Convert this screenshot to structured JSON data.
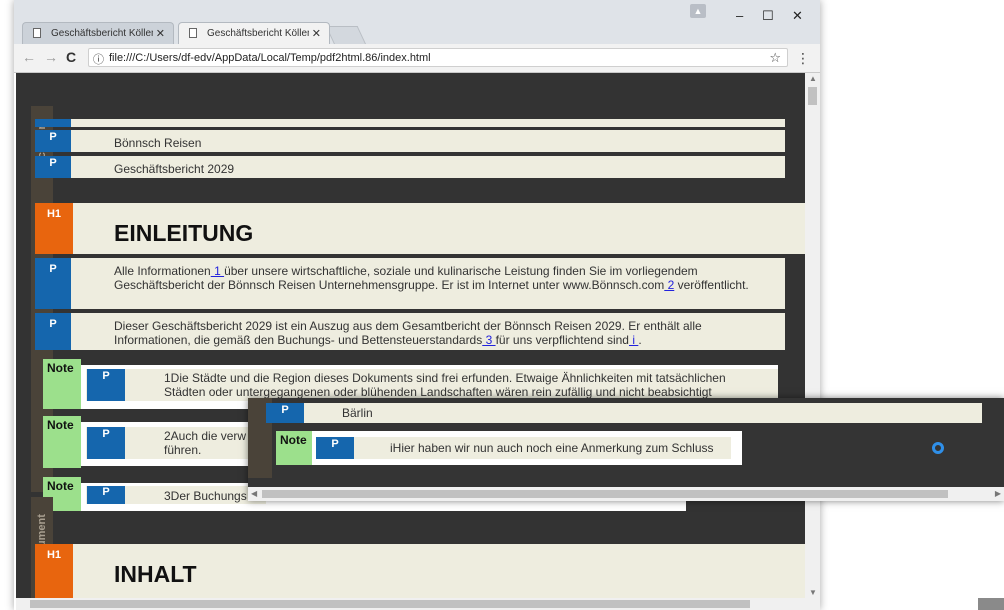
{
  "browser": {
    "tabs": [
      {
        "title": "Geschäftsbericht Köllen ("
      },
      {
        "title": "Geschäftsbericht Köllen R"
      }
    ],
    "url": "file:///C:/Users/df-edv/AppData/Local/Temp/pdf2html.86/index.html",
    "window_controls": {
      "minimize": "–",
      "maximize": "☐",
      "close": "✕"
    }
  },
  "labels": {
    "document": "Document",
    "p": "P",
    "h1": "H1",
    "note": "Note"
  },
  "content": {
    "p_top": "Bönnsch Reisen",
    "p_report": "Geschäftsbericht 2029",
    "h1_intro": "EINLEITUNG",
    "p1": {
      "a": "Alle Informationen",
      "link1": " 1 ",
      "b": "über unsere wirtschaftliche, soziale und kulinarische Leistung finden Sie im vorliegendem Geschäftsbericht der Bönnsch Reisen Unternehmensgruppe. Er ist im Internet unter www.Bönnsch.com",
      "link2": " 2",
      "c": " veröffentlicht."
    },
    "p2": {
      "a": "Dieser Geschäftsbericht 2029 ist ein Auszug aus dem Gesamtbericht der Bönnsch Reisen 2029. Er enthält alle Informationen, die gemäß den Buchungs- und Bettensteuerstandards",
      "link1": " 3 ",
      "b": "für uns verpflichtend sind",
      "link2": " i ",
      "c": "."
    },
    "note1": "1Die Städte und die Region dieses Dokuments sind frei erfunden. Etwaige Ähnlichkeiten mit tatsächlichen Städten oder untergegangenen oder blühenden Landschaften wären rein zufällig und nicht beabsichtigt",
    "note2_a": "2Auch die verw",
    "note2_b": "führen.",
    "note3": "3Der Buchungs",
    "h1_content": "INHALT"
  },
  "overlay": {
    "p_city": "Bärlin",
    "note_text": "iHier haben wir nun auch noch eine Anmerkung zum Schluss"
  }
}
